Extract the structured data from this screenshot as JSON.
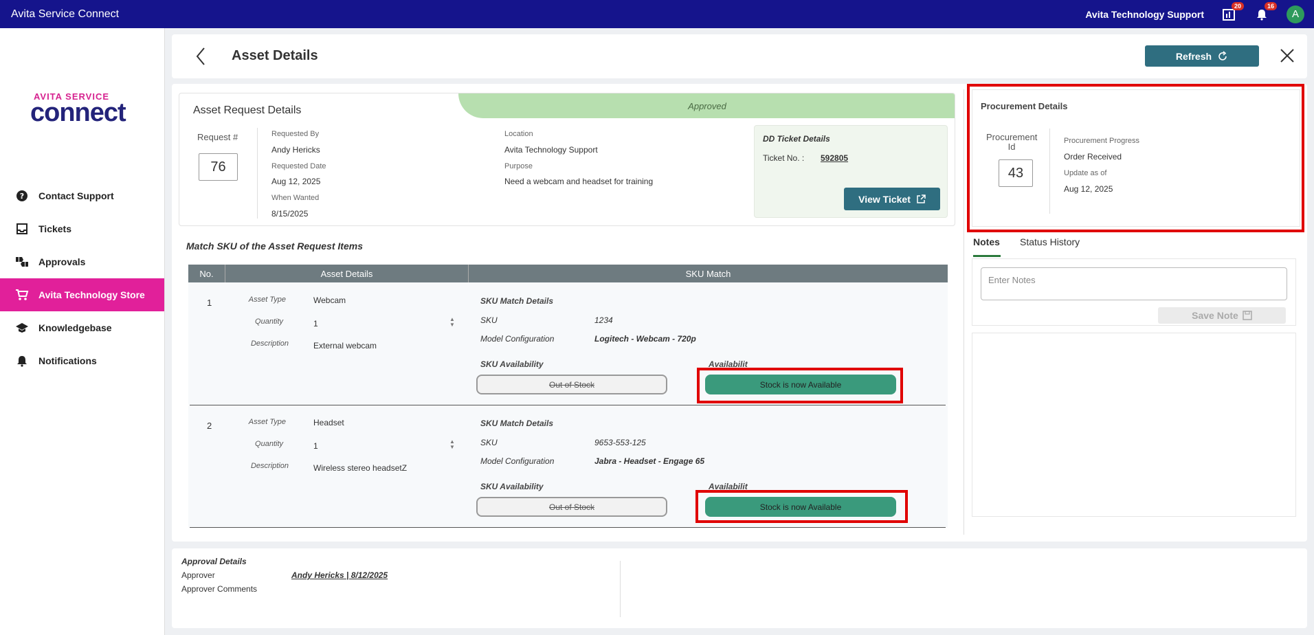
{
  "topbar": {
    "app_title": "Avita Service Connect",
    "org": "Avita Technology Support",
    "reports_badge": "20",
    "notifications_badge": "16",
    "avatar_letter": "A"
  },
  "logo": {
    "top": "AVITA SERVICE",
    "main": "connect"
  },
  "sidebar": {
    "items": [
      {
        "label": "Contact Support",
        "icon": "help-circle-icon"
      },
      {
        "label": "Tickets",
        "icon": "inbox-icon"
      },
      {
        "label": "Approvals",
        "icon": "thumbs-icon"
      },
      {
        "label": "Avita Technology Store",
        "icon": "cart-icon"
      },
      {
        "label": "Knowledgebase",
        "icon": "graduation-cap-icon"
      },
      {
        "label": "Notifications",
        "icon": "bell-icon"
      }
    ]
  },
  "header": {
    "title": "Asset Details",
    "refresh_label": "Refresh"
  },
  "request": {
    "title": "Asset Request Details",
    "status": "Approved",
    "request_num_label": "Request #",
    "request_num": "76",
    "requested_by_label": "Requested By",
    "requested_by": "Andy Hericks",
    "requested_date_label": "Requested Date",
    "requested_date": "Aug 12, 2025",
    "when_wanted_label": "When Wanted",
    "when_wanted": "8/15/2025",
    "location_label": "Location",
    "location": "Avita Technology Support",
    "purpose_label": "Purpose",
    "purpose": "Need a webcam and headset for training"
  },
  "dd_ticket": {
    "title": "DD Ticket Details",
    "ticket_label": "Ticket No. :",
    "ticket_no": "592805",
    "view_label": "View Ticket"
  },
  "match": {
    "title": "Match SKU of the Asset Request Items",
    "columns": [
      "No.",
      "Asset Details",
      "SKU Match"
    ],
    "labels": {
      "asset_type": "Asset Type",
      "quantity": "Quantity",
      "description": "Description",
      "sku_match_details": "SKU Match Details",
      "sku": "SKU",
      "model_config": "Model Configuration",
      "sku_availability": "SKU Availability",
      "availability": "Availabilit"
    },
    "rows": [
      {
        "no": "1",
        "asset_type": "Webcam",
        "quantity": "1",
        "description": "External webcam",
        "sku": "1234",
        "model_config": "Logitech - Webcam - 720p",
        "sku_status": "Out of Stock",
        "availability": "Stock is now Available"
      },
      {
        "no": "2",
        "asset_type": "Headset",
        "quantity": "1",
        "description": "Wireless stereo headsetZ",
        "sku": "9653-553-125",
        "model_config": "Jabra - Headset - Engage 65",
        "sku_status": "Out of Stock",
        "availability": "Stock is now Available"
      }
    ]
  },
  "procurement": {
    "title": "Procurement Details",
    "id_label": "Procurement Id",
    "id": "43",
    "progress_label": "Procurement Progress",
    "progress": "Order Received",
    "update_label": "Update as of",
    "update_date": "Aug 12, 2025"
  },
  "notes": {
    "tabs": [
      "Notes",
      "Status History"
    ],
    "placeholder": "Enter Notes",
    "save_label": "Save Note"
  },
  "approval": {
    "title": "Approval Details",
    "approver_label": "Approver",
    "approver": "Andy Hericks | 8/12/2025",
    "comments_label": "Approver Comments"
  },
  "colors": {
    "topbar": "#15148c",
    "accent": "#e1209a",
    "button": "#2f6e80",
    "available": "#3a9a7c",
    "highlight": "#e00000"
  }
}
